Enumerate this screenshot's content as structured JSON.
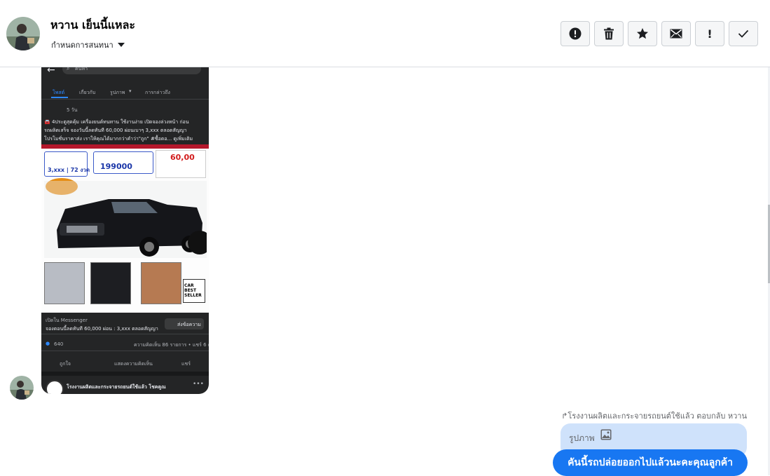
{
  "header": {
    "contact_name": "หวาน เย็นนี้แหละ",
    "chat_setting_label": "กำหนดการสนทนา",
    "toolbar": [
      {
        "name": "report-spam-button",
        "icon": "alert-circle-icon"
      },
      {
        "name": "delete-button",
        "icon": "trash-icon"
      },
      {
        "name": "star-button",
        "icon": "star-icon"
      },
      {
        "name": "mark-unread-button",
        "icon": "envelope-icon"
      },
      {
        "name": "important-button",
        "icon": "exclamation-icon"
      },
      {
        "name": "done-button",
        "icon": "check-icon"
      }
    ]
  },
  "screenshot": {
    "search_placeholder": "ค้นหา",
    "tabs": [
      "โพสต์",
      "เกี่ยวกับ",
      "รูปภาพ",
      "การกล่าวถึง"
    ],
    "post_time": "5 วัน",
    "post_text_1": "🚘 4ประตูสุดคุ้ม เครื่องยนต์ทนทาน ใช้งานง่าย เปิดจองล่วงหน้า ก่อน",
    "post_text_2": "รถผลิตเสร็จ จองวันนี้ลดทันที 60,000 ผ่อนเบาๆ 3,xxx ตลอดสัญญา",
    "post_text_3": "โปรโมชั่นราคาส่ง เราให้คุณได้มากกว่าคำว่า\"ถูก\" #ซื้อตอ... ดูเพิ่มเติม",
    "ad_price": "199000",
    "ad_monthly": "3,xxx | 72 งวด",
    "ad_discount": "60,00",
    "ad_brand": "CAR BEST SELLER",
    "messenger_label": "เปิดใน Messenger",
    "messenger_text": "จองตอนนี้ลดทันที 60,000 ผ่อน : 3,xxx ตลอดสัญญา",
    "send_message": "ส่งข้อความ",
    "likes": "640",
    "comments_shares": "ความคิดเห็น 86 รายการ • แชร์ 6 ครั้ง",
    "like_btn": "ถูกใจ",
    "comment_btn": "แสดงความคิดเห็น",
    "share_btn": "แชร์",
    "page_name": "โรงงานผลิตและกระจายรถยนต์ใช้แล้ว โชคคูณ"
  },
  "reply": {
    "meta": "โรงงานผลิตและกระจายรถยนต์ใช้แล้ว ตอบกลับ หวาน",
    "quote_label": "รูปภาพ",
    "message": "คันนี้รถปล่อยออกไปแล้วนะคะคุณลูกค้า"
  }
}
